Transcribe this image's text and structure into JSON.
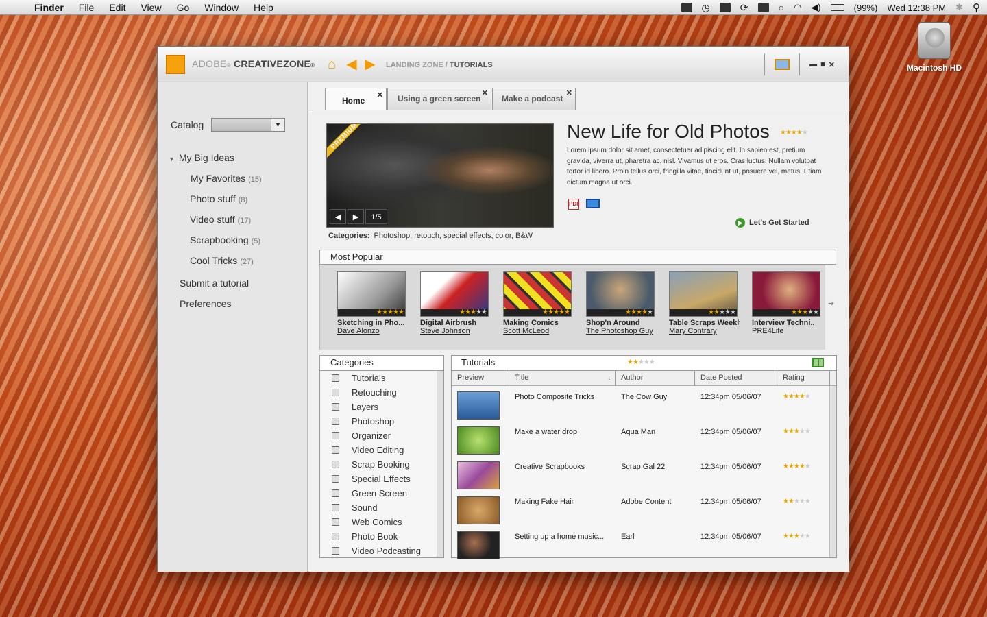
{
  "menubar": {
    "app": "Finder",
    "items": [
      "File",
      "Edit",
      "View",
      "Go",
      "Window",
      "Help"
    ],
    "battery": "(99%)",
    "clock": "Wed 12:38 PM"
  },
  "desktop": {
    "hd_label": "Macintosh HD"
  },
  "app": {
    "brand_prefix": "ADOBE",
    "brand_suffix": "CREATIVEZONE",
    "crumb_parent": "LANDING ZONE /",
    "crumb_current": "TUTORIALS"
  },
  "sidebar": {
    "catalog_label": "Catalog",
    "group": "My Big Ideas",
    "items": [
      {
        "label": "My Favorites",
        "count": "(15)"
      },
      {
        "label": "Photo stuff",
        "count": "(8)"
      },
      {
        "label": "Video stuff",
        "count": "(17)"
      },
      {
        "label": "Scrapbooking",
        "count": "(5)"
      },
      {
        "label": "Cool Tricks",
        "count": "(27)"
      }
    ],
    "submit": "Submit a tutorial",
    "prefs": "Preferences"
  },
  "tabs": [
    "Home",
    "Using a green screen",
    "Make a podcast"
  ],
  "featured": {
    "badge": "PREMIUM",
    "counter": "1/5",
    "title": "New Life for Old Photos",
    "rating": 4,
    "desc": "Lorem ipsum dolor sit amet, consectetuer adipiscing elit. In sapien est, pretium gravida, viverra ut, pharetra ac, nisl. Vivamus ut eros. Cras luctus. Nullam volutpat tortor id libero. Proin tellus orci, fringilla vitae, tincidunt ut, posuere vel, metus. Etiam dictum magna ut orci.",
    "cta": "Let's Get Started",
    "categories_label": "Categories:",
    "categories": "Photoshop, retouch, special effects, color, B&W"
  },
  "most_popular": {
    "title": "Most Popular",
    "items": [
      {
        "title": "Sketching in Pho...",
        "author": "Dave Alonzo",
        "rating": 5
      },
      {
        "title": "Digital Airbrush",
        "author": "Steve Johnson",
        "rating": 3
      },
      {
        "title": "Making Comics",
        "author": "Scott McLeod",
        "rating": 5
      },
      {
        "title": "Shop'n Around",
        "author": "The Photoshop Guy",
        "rating": 4
      },
      {
        "title": "Table Scraps Weekly",
        "author": "Mary Contrary",
        "rating": 2
      },
      {
        "title": "Interview Techni..",
        "author": "PRE4Life",
        "rating": 3
      }
    ]
  },
  "categories": {
    "title": "Categories",
    "items": [
      "Tutorials",
      "Retouching",
      "Layers",
      "Photoshop",
      "Organizer",
      "Video Editing",
      "Scrap Booking",
      "Special Effects",
      "Green Screen",
      "Sound",
      "Web Comics",
      "Photo Book",
      "Video Podcasting"
    ]
  },
  "tutorials": {
    "title": "Tutorials",
    "header_rating": 2,
    "columns": [
      "Preview",
      "Title",
      "Author",
      "Date Posted",
      "Rating"
    ],
    "rows": [
      {
        "title": "Photo Composite Tricks",
        "author": "The Cow Guy",
        "date": "12:34pm 05/06/07",
        "rating": 4
      },
      {
        "title": "Make a water drop",
        "author": "Aqua Man",
        "date": "12:34pm 05/06/07",
        "rating": 3
      },
      {
        "title": "Creative Scrapbooks",
        "author": "Scrap Gal 22",
        "date": "12:34pm 05/06/07",
        "rating": 4
      },
      {
        "title": "Making Fake Hair",
        "author": "Adobe  Content",
        "date": "12:34pm 05/06/07",
        "rating": 2
      },
      {
        "title": "Setting up a home music...",
        "author": "Earl",
        "date": "12:34pm 05/06/07",
        "rating": 3
      }
    ]
  },
  "colors": {
    "accent": "#f7a20c",
    "star": "#e6a800"
  }
}
